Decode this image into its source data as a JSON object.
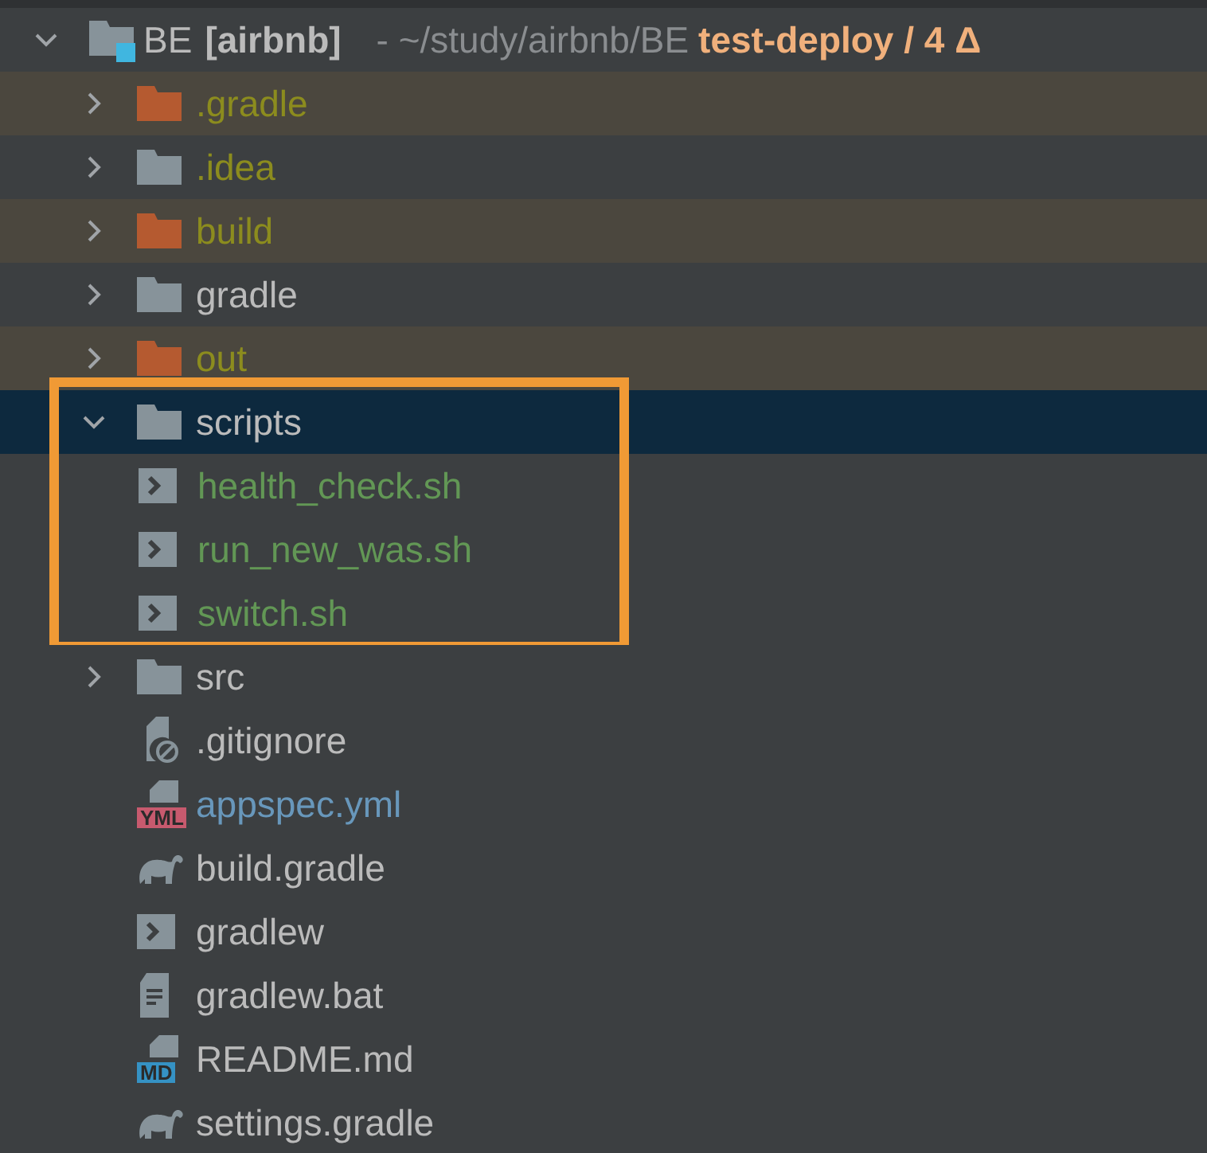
{
  "tree": {
    "name": "BE",
    "module": "[airbnb]",
    "path": "- ~/study/airbnb/BE",
    "branch": "test-deploy / 4 Δ",
    "kind": "module",
    "expanded": true,
    "selected": false,
    "ignored": false,
    "color": "#bbbbbb",
    "children": [
      {
        "name": ".gradle",
        "kind": "folder",
        "expanded": false,
        "selected": false,
        "ignored": true,
        "color": "#8c8c1e",
        "highlighted": false
      },
      {
        "name": ".idea",
        "kind": "folder",
        "expanded": false,
        "selected": false,
        "ignored": false,
        "color": "#8c8c1e",
        "highlighted": false
      },
      {
        "name": "build",
        "kind": "folder",
        "expanded": false,
        "selected": false,
        "ignored": true,
        "color": "#8c8c1e",
        "highlighted": false
      },
      {
        "name": "gradle",
        "kind": "folder",
        "expanded": false,
        "selected": false,
        "ignored": false,
        "color": "#bbbbbb",
        "highlighted": false
      },
      {
        "name": "out",
        "kind": "folder",
        "expanded": false,
        "selected": false,
        "ignored": true,
        "color": "#8c8c1e",
        "highlighted": false
      },
      {
        "name": "scripts",
        "kind": "folder",
        "expanded": true,
        "selected": true,
        "ignored": false,
        "color": "#bbbbbb",
        "highlighted": true,
        "children": [
          {
            "name": "health_check.sh",
            "kind": "shell",
            "selected": false,
            "ignored": false,
            "color": "#629755"
          },
          {
            "name": "run_new_was.sh",
            "kind": "shell",
            "selected": false,
            "ignored": false,
            "color": "#629755"
          },
          {
            "name": "switch.sh",
            "kind": "shell",
            "selected": false,
            "ignored": false,
            "color": "#629755"
          }
        ]
      },
      {
        "name": "src",
        "kind": "folder",
        "expanded": false,
        "selected": false,
        "ignored": false,
        "color": "#bbbbbb",
        "highlighted": false
      },
      {
        "name": ".gitignore",
        "kind": "ignorefile",
        "selected": false,
        "ignored": false,
        "color": "#bbbbbb"
      },
      {
        "name": "appspec.yml",
        "kind": "labeled",
        "badge": {
          "text": "YML",
          "color": "#c75a6e"
        },
        "selected": false,
        "ignored": false,
        "color": "#6897bb"
      },
      {
        "name": "build.gradle",
        "kind": "gradle",
        "selected": false,
        "ignored": false,
        "color": "#bbbbbb"
      },
      {
        "name": "gradlew",
        "kind": "shell",
        "selected": false,
        "ignored": false,
        "color": "#bbbbbb"
      },
      {
        "name": "gradlew.bat",
        "kind": "text",
        "selected": false,
        "ignored": false,
        "color": "#bbbbbb"
      },
      {
        "name": "README.md",
        "kind": "labeled",
        "badge": {
          "text": "MD",
          "color": "#3592c4"
        },
        "selected": false,
        "ignored": false,
        "color": "#bbbbbb"
      },
      {
        "name": "settings.gradle",
        "kind": "gradle",
        "selected": false,
        "ignored": false,
        "color": "#bbbbbb"
      }
    ]
  }
}
